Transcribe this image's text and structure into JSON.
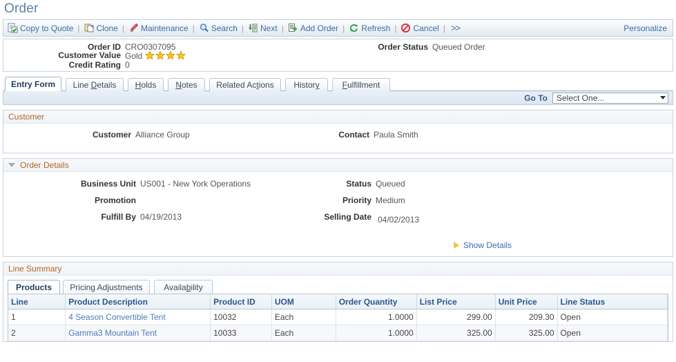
{
  "page": {
    "title": "Order"
  },
  "toolbar": {
    "items": [
      {
        "label": "Copy to Quote",
        "icon": "copy-to-quote-icon"
      },
      {
        "label": "Clone",
        "icon": "clone-icon"
      },
      {
        "label": "Maintenance",
        "icon": "maintenance-pencil-icon"
      },
      {
        "label": "Search",
        "icon": "search-magnifier-icon"
      },
      {
        "label": "Next",
        "icon": "next-icon"
      },
      {
        "label": "Add Order",
        "icon": "add-order-icon"
      },
      {
        "label": "Refresh",
        "icon": "refresh-icon"
      },
      {
        "label": "Cancel",
        "icon": "cancel-icon"
      }
    ],
    "separator": "|",
    "more_label": ">>",
    "personalize_label": "Personalize"
  },
  "header": {
    "order_id_label": "Order ID",
    "order_id_value": "CRO0307095",
    "customer_value_label": "Customer Value",
    "customer_value_value": "Gold",
    "customer_value_stars": 4,
    "credit_rating_label": "Credit Rating",
    "credit_rating_value": "0",
    "order_status_label": "Order Status",
    "order_status_value": "Queued Order"
  },
  "tabs": [
    {
      "label": "Entry Form",
      "accel": "",
      "active": true
    },
    {
      "label": "Line Details",
      "accel": "D",
      "active": false
    },
    {
      "label": "Holds",
      "accel": "H",
      "active": false
    },
    {
      "label": "Notes",
      "accel": "N",
      "active": false
    },
    {
      "label": "Related Actions",
      "accel": "ti",
      "active": false
    },
    {
      "label": "History",
      "accel": "y",
      "active": false
    },
    {
      "label": "Fulfillment",
      "accel": "F",
      "active": false
    }
  ],
  "goto": {
    "label": "Go To",
    "selected": "Select One...",
    "options": [
      "Select One..."
    ]
  },
  "customer_section": {
    "title": "Customer",
    "customer_label": "Customer",
    "customer_value": "Alliance Group",
    "contact_label": "Contact",
    "contact_value": "Paula Smith"
  },
  "order_details": {
    "title": "Order Details",
    "business_unit_label": "Business Unit",
    "business_unit_value": "US001 - New York Operations",
    "promotion_label": "Promotion",
    "promotion_value": "",
    "fulfill_by_label": "Fulfill By",
    "fulfill_by_value": "04/19/2013",
    "status_label": "Status",
    "status_value": "Queued",
    "priority_label": "Priority",
    "priority_value": "Medium",
    "selling_date_label": "Selling Date",
    "selling_date_value": "04/02/2013",
    "show_details_label": "Show Details"
  },
  "line_summary": {
    "title": "Line Summary",
    "tabs": [
      {
        "label": "Products",
        "accel": "",
        "active": true
      },
      {
        "label": "Pricing Adjustments",
        "accel": "j",
        "active": false
      },
      {
        "label": "Availability",
        "accel": "b",
        "active": false
      }
    ],
    "columns": [
      "Line",
      "Product Description",
      "Product ID",
      "UOM",
      "Order Quantity",
      "List Price",
      "Unit Price",
      "Line Status"
    ],
    "rows": [
      {
        "line": "1",
        "product_description": "4 Season Convertible Tent",
        "product_id": "10032",
        "uom": "Each",
        "order_quantity": "1.0000",
        "list_price": "299.00",
        "unit_price": "209.30",
        "line_status": "Open"
      },
      {
        "line": "2",
        "product_description": "Gamma3 Mountain Tent",
        "product_id": "10033",
        "uom": "Each",
        "order_quantity": "1.0000",
        "list_price": "325.00",
        "unit_price": "325.00",
        "line_status": "Open"
      }
    ]
  },
  "colors": {
    "title_blue": "#5b7fa6",
    "link_blue": "#3b6ea5",
    "section_orange": "#b5651d",
    "grid_header_blue": "#2b568c",
    "star_gold": "#f5c518"
  }
}
